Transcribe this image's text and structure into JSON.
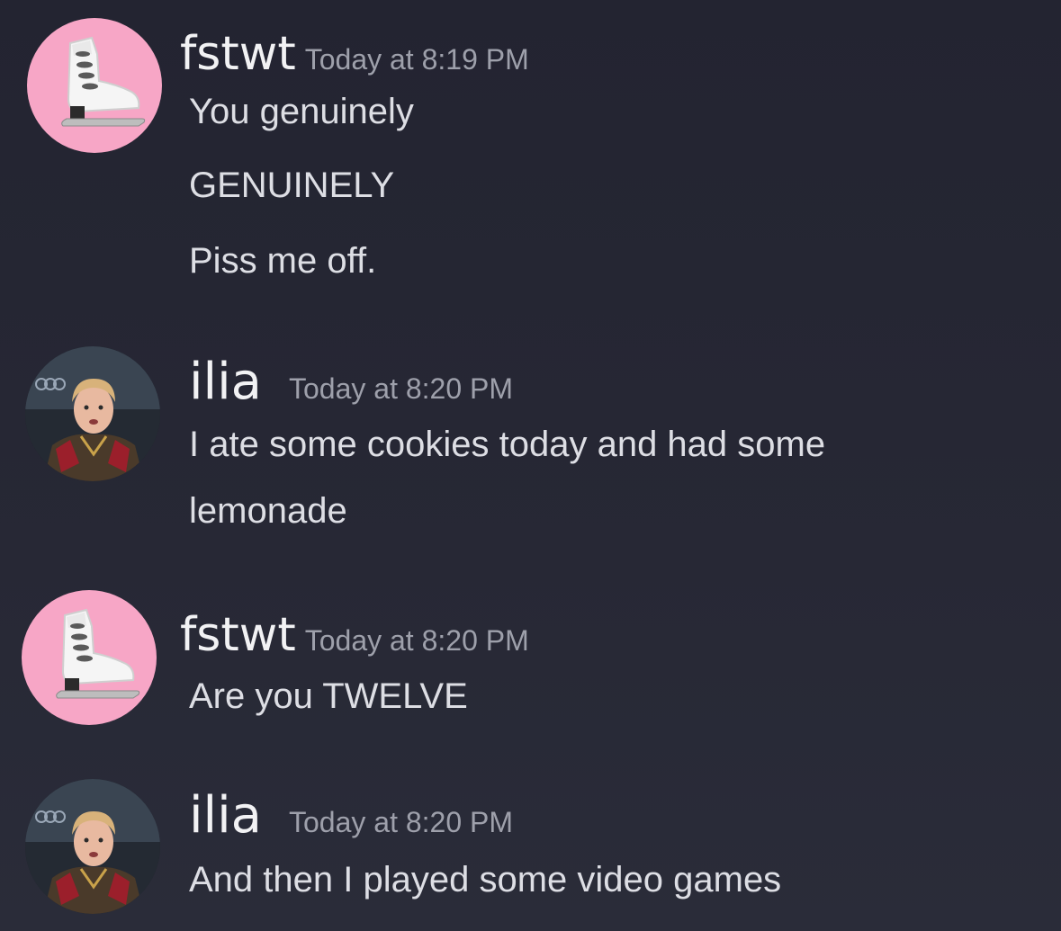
{
  "messages": [
    {
      "username": "fstwt",
      "timestamp": "Today at 8:19 PM",
      "avatar": "ice-skate-icon",
      "lines": [
        "You genuinely",
        "GENUINELY",
        "Piss me off."
      ]
    },
    {
      "username": "ilia",
      "timestamp": "Today at 8:20 PM",
      "avatar": "skater-photo",
      "lines": [
        "I ate some cookies today and had some",
        "lemonade"
      ]
    },
    {
      "username": "fstwt",
      "timestamp": "Today at 8:20 PM",
      "avatar": "ice-skate-icon",
      "lines": [
        "Are you TWELVE"
      ]
    },
    {
      "username": "ilia",
      "timestamp": "Today at 8:20 PM",
      "avatar": "skater-photo",
      "lines": [
        "And then I played some video games"
      ]
    }
  ],
  "colors": {
    "background": "#262734",
    "username": "#f2f2f4",
    "timestamp": "#9ea0ab",
    "message_text": "#dddee4",
    "skate_avatar_bg": "#f7a6c6"
  }
}
